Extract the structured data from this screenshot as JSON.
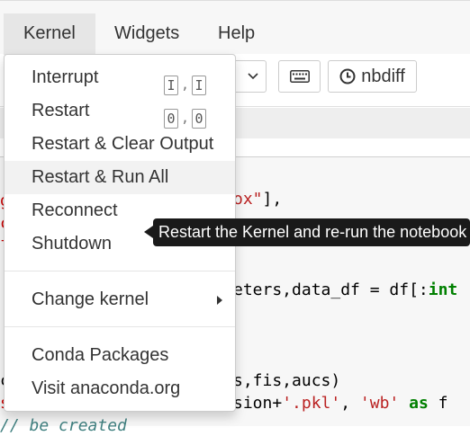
{
  "menubar": {
    "kernel": "Kernel",
    "widgets": "Widgets",
    "help": "Help"
  },
  "toolbar": {
    "nbdiff_label": "nbdiff"
  },
  "kernel_menu": {
    "interrupt": "Interrupt",
    "interrupt_keys": [
      "I",
      ",",
      "I"
    ],
    "restart": "Restart",
    "restart_keys": [
      "0",
      ",",
      "0"
    ],
    "restart_clear": "Restart & Clear Output",
    "restart_run_all": "Restart & Run All",
    "reconnect": "Reconnect",
    "shutdown": "Shutdown",
    "change_kernel": "Change kernel",
    "conda_packages": "Conda Packages",
    "visit_anaconda": "Visit anaconda.org"
  },
  "tooltip": {
    "text": "Restart the Kernel and re-run the notebook"
  },
  "code": {
    "line1_str": "ox\"",
    "line1_rest": "],",
    "line2_var": "eters,data_df = df[:",
    "line2_kw": "int",
    "line3": "s,fis,aucs)",
    "line4_pre": "sion+",
    "line4_str": "'.pkl'",
    "line4_mid": ", ",
    "line4_str2": "'wb'",
    "line4_kw": "as",
    "line4_end": " f",
    "line5_cm": "// be created"
  },
  "colors": {
    "menubar_bg": "#f7f7f7",
    "active_menu_bg": "#e6e6e6",
    "tooltip_bg": "#1a1a1a"
  }
}
